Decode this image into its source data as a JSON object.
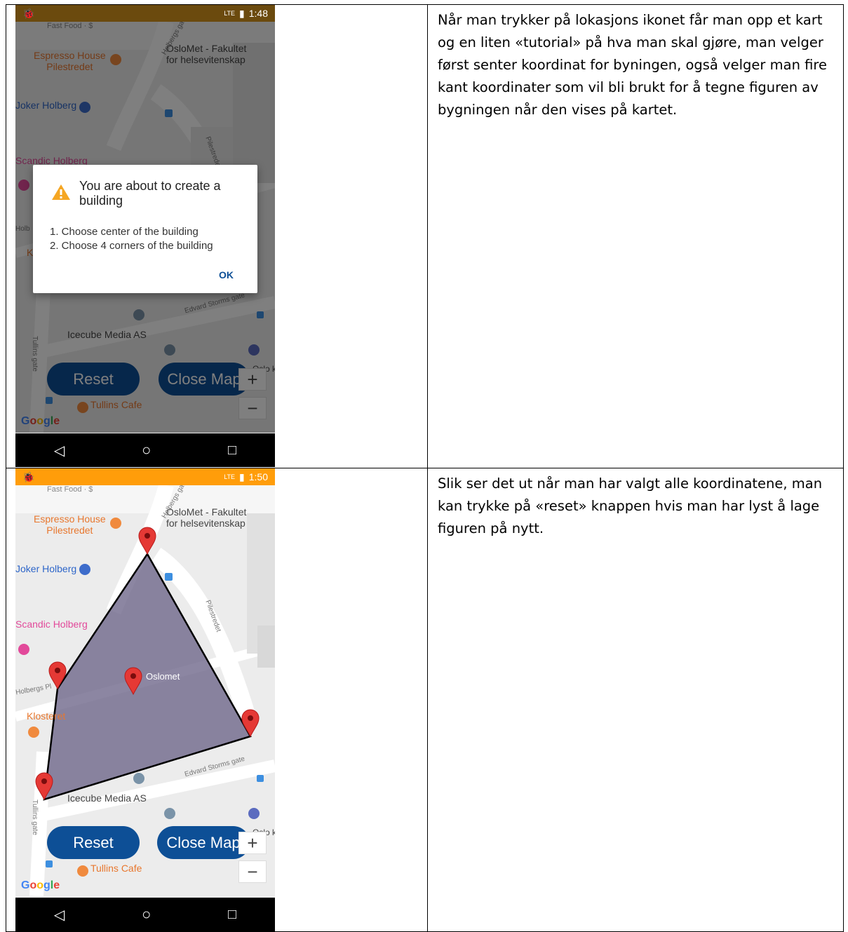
{
  "rows": [
    {
      "phone": {
        "statusbar_color": "#6b4a0e",
        "time": "1:48",
        "network": "LTE",
        "map": {
          "labels": {
            "espresso": "Espresso House\nPilestredet",
            "oslomet_fak": "OsloMet - Fakultet\nfor helsevitenskap",
            "joker": "Joker Holberg",
            "scandic": "Scandic Holberg",
            "icecube": "Icecube Media AS",
            "tullins": "Tullins Cafe",
            "oslo_k": "Oslo k",
            "street_holbergs": "Holbergs gate",
            "street_pilestredet": "Pilestredet",
            "street_edvard": "Edvard Storms gate",
            "street_tullins": "Tullins gate",
            "fast_food": "Fast Food · $",
            "holb": "Holb",
            "k": "K"
          },
          "google": "Google"
        },
        "buttons": {
          "reset": "Reset",
          "close": "Close Map"
        },
        "dialog": {
          "title": "You are about to create a building",
          "line1": "1. Choose center of the building",
          "line2": "2. Choose 4 corners of the building",
          "ok": "OK"
        }
      },
      "text": "Når man trykker på lokasjons ikonet får man opp et kart og en liten «tutorial» på hva man skal gjøre, man velger først senter koordinat for byningen, også velger man fire kant koordinater som vil bli brukt for å tegne figuren av bygningen når den vises på kartet."
    },
    {
      "phone": {
        "statusbar_color": "#ff9d0a",
        "time": "1:50",
        "network": "LTE",
        "map": {
          "labels": {
            "espresso": "Espresso House\nPilestredet",
            "oslomet_fak": "OsloMet - Fakultet\nfor helsevitenskap",
            "joker": "Joker Holberg",
            "scandic": "Scandic Holberg",
            "icecube": "Icecube Media AS",
            "tullins": "Tullins Cafe",
            "oslo_k": "Oslo k",
            "oslomet": "Oslomet",
            "klosteret": "Klosteret",
            "street_holbergs": "Holbergs gate",
            "street_holbergs_pl": "Holbergs Pl",
            "street_pilestredet": "Pilestredet",
            "street_edvard": "Edvard Storms gate",
            "street_tullins": "Tullins gate",
            "fast_food": "Fast Food · $"
          },
          "google": "Google"
        },
        "buttons": {
          "reset": "Reset",
          "close": "Close Map"
        }
      },
      "text": "Slik ser det ut når man har valgt alle koordinatene, man kan trykke på «reset» knappen hvis man har lyst å lage figuren på nytt."
    }
  ]
}
